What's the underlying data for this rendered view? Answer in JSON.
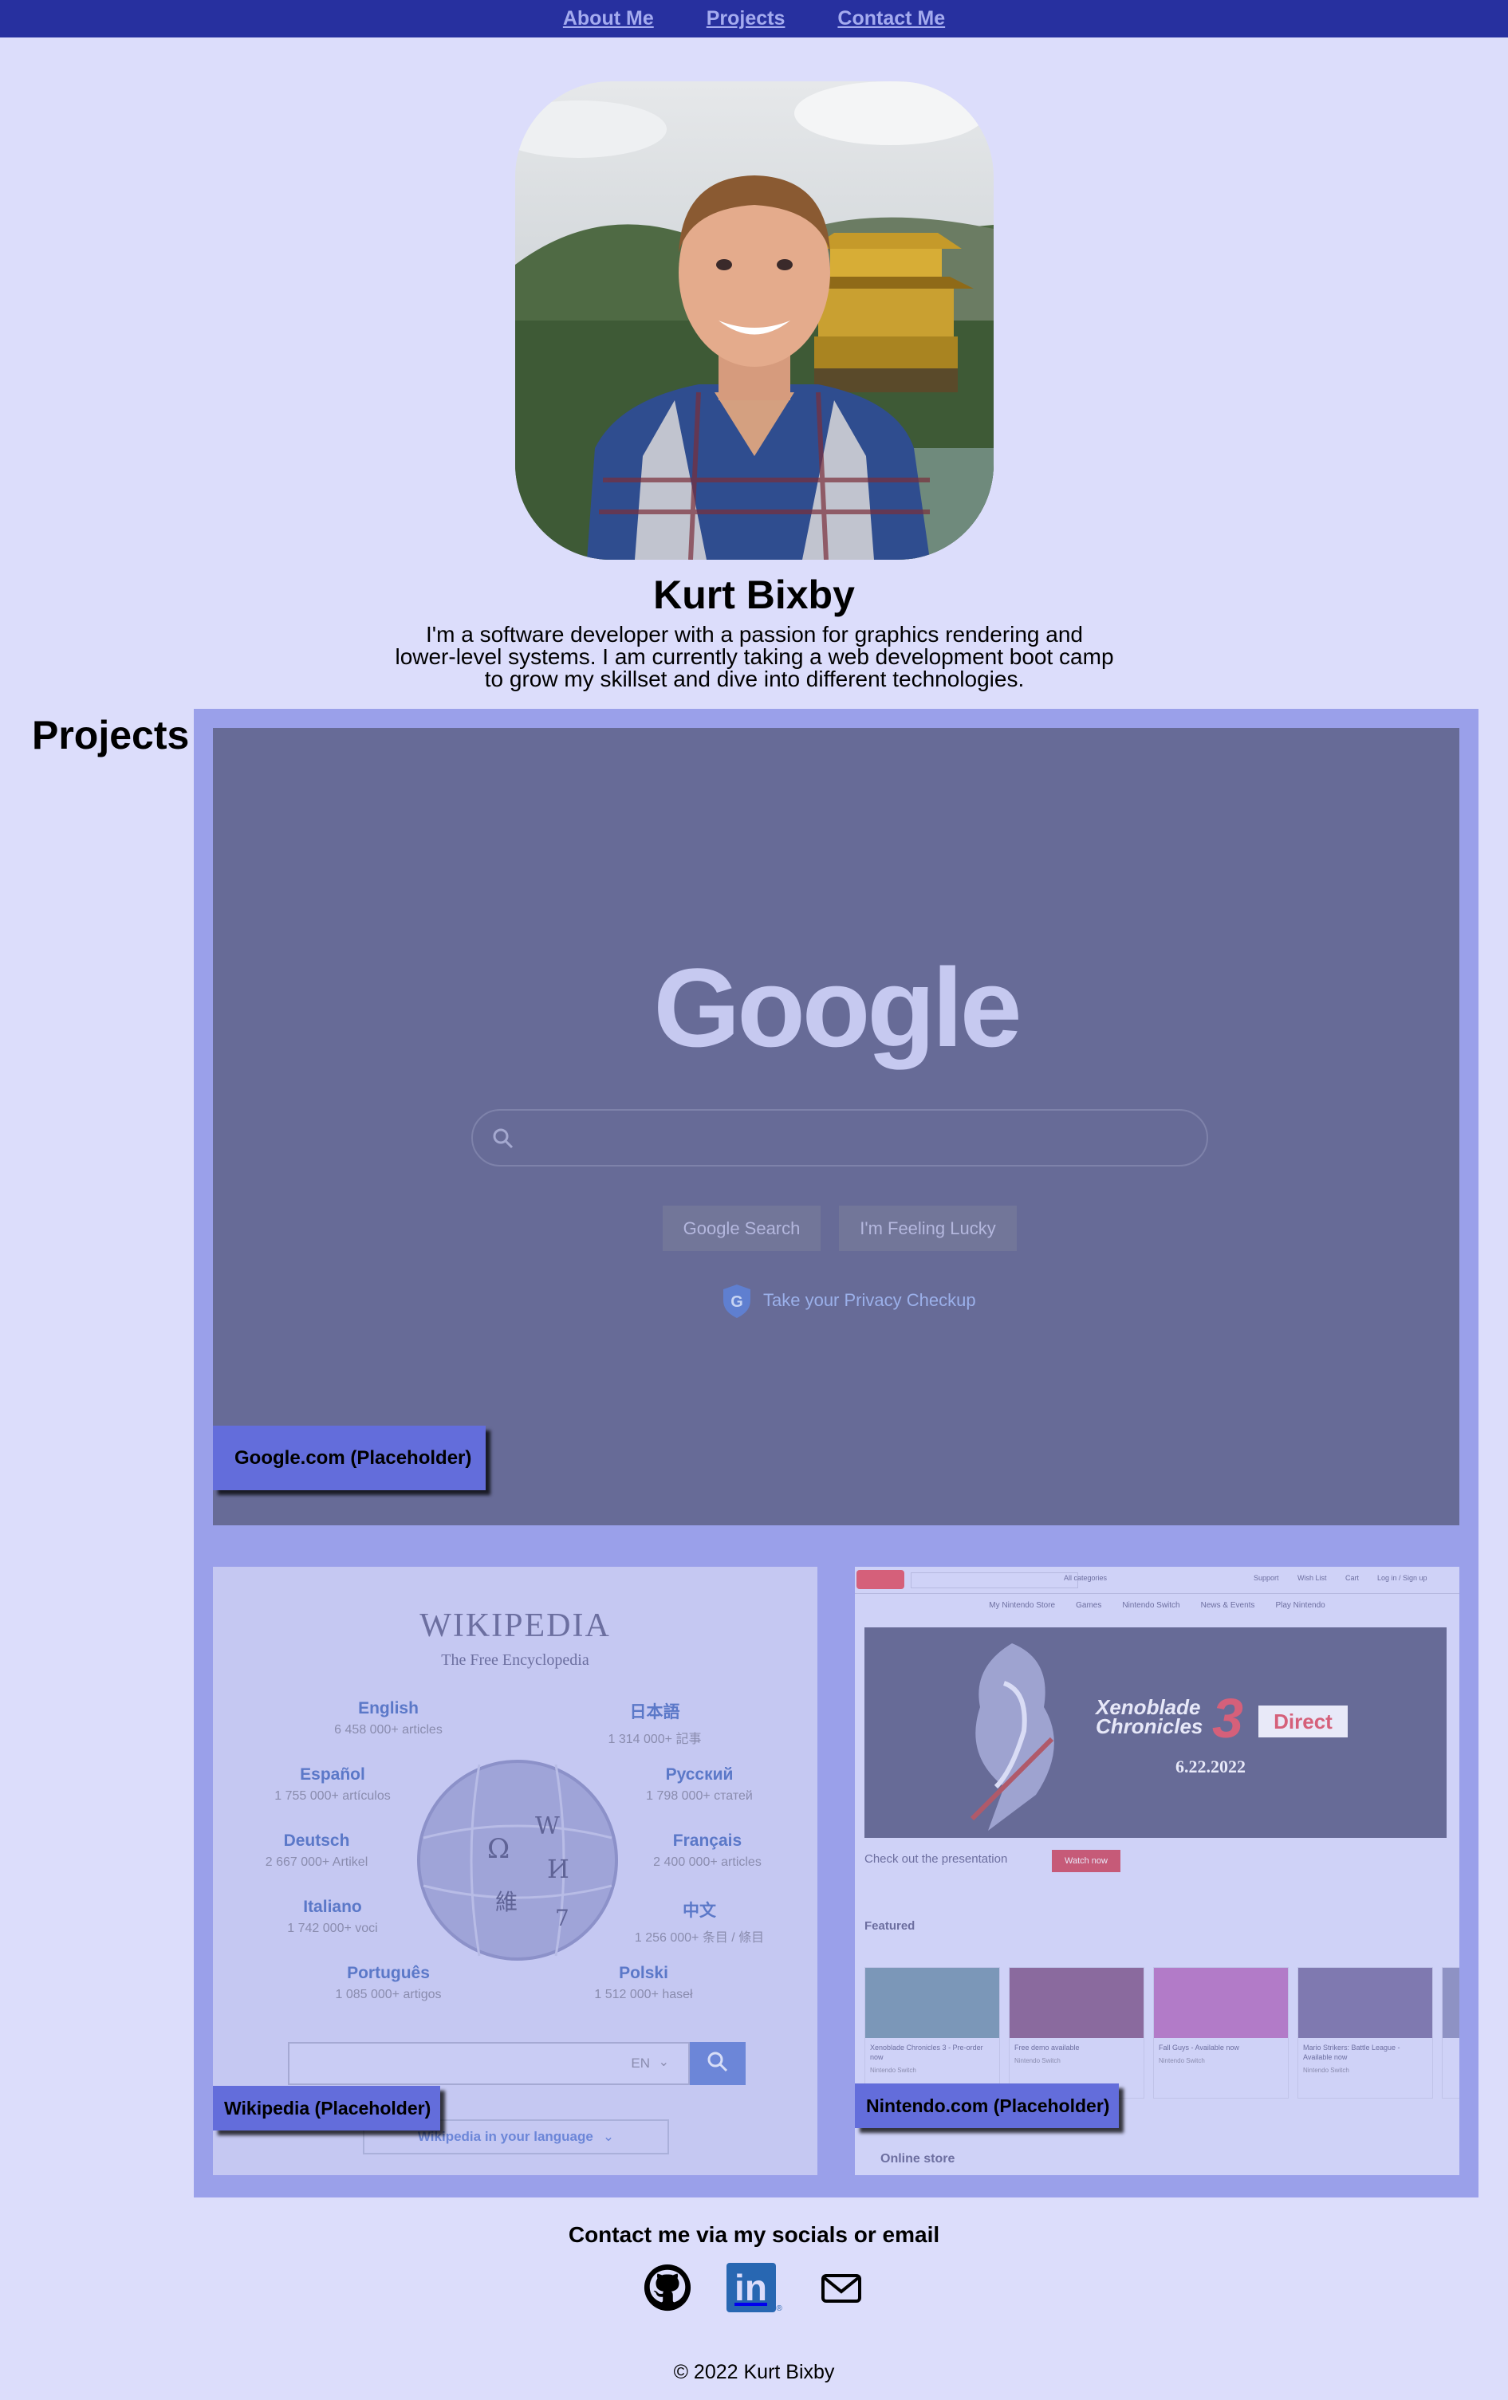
{
  "nav": {
    "items": [
      {
        "label": "About Me"
      },
      {
        "label": "Projects"
      },
      {
        "label": "Contact Me"
      }
    ]
  },
  "profile": {
    "name": "Kurt Bixby",
    "bio": "I'm a software developer with a passion for graphics rendering and lower-level systems. I am currently taking a web development boot camp to grow my skillset and dive into different technologies."
  },
  "projects": {
    "heading": "Projects",
    "items": [
      {
        "label": "Google.com (Placeholder)"
      },
      {
        "label": "Wikipedia (Placeholder)"
      },
      {
        "label": "Nintendo.com (Placeholder)"
      }
    ]
  },
  "google_preview": {
    "logo": "Google",
    "buttons": [
      "Google Search",
      "I'm Feeling Lucky"
    ],
    "privacy": "Take your Privacy Checkup"
  },
  "wiki_preview": {
    "title": "WIKIPEDIA",
    "tagline": "The Free Encyclopedia",
    "languages": [
      {
        "name": "English",
        "count": "6 458 000+ articles"
      },
      {
        "name": "日本語",
        "count": "1 314 000+ 記事"
      },
      {
        "name": "Español",
        "count": "1 755 000+ artículos"
      },
      {
        "name": "Русский",
        "count": "1 798 000+ статей"
      },
      {
        "name": "Deutsch",
        "count": "2 667 000+ Artikel"
      },
      {
        "name": "Français",
        "count": "2 400 000+ articles"
      },
      {
        "name": "Italiano",
        "count": "1 742 000+ voci"
      },
      {
        "name": "中文",
        "count": "1 256 000+ 条目 / 條目"
      },
      {
        "name": "Português",
        "count": "1 085 000+ artigos"
      },
      {
        "name": "Polski",
        "count": "1 512 000+ haseł"
      }
    ],
    "lang_code": "EN",
    "language_button": "Wikipedia in your language"
  },
  "nintendo_preview": {
    "top_links": [
      "Support",
      "Wish List",
      "Cart",
      "Log in / Sign up"
    ],
    "categories": "All categories",
    "nav_items": [
      "My Nintendo Store",
      "Games",
      "Nintendo Switch",
      "News & Events",
      "Play Nintendo"
    ],
    "banner_title_line1": "Xenoblade",
    "banner_title_line2": "Chronicles",
    "banner_number": "3",
    "banner_direct": "Direct",
    "banner_date": "6.22.2022",
    "presentation_text": "Check out the presentation",
    "watch_now": "Watch now",
    "featured": "Featured",
    "featured_items": [
      {
        "title": "Xenoblade Chronicles 3 - Pre-order now",
        "platform": "Nintendo Switch"
      },
      {
        "title": "Free demo available",
        "platform": "Nintendo Switch"
      },
      {
        "title": "Fall Guys - Available now",
        "platform": "Nintendo Switch"
      },
      {
        "title": "Mario Strikers: Battle League - Available now",
        "platform": "Nintendo Switch"
      }
    ],
    "online_store": "Online store"
  },
  "contact": {
    "heading": "Contact me via my socials or email",
    "socials": [
      {
        "icon": "github-icon"
      },
      {
        "icon": "linkedin-icon",
        "text": "in"
      },
      {
        "icon": "mail-icon"
      }
    ]
  },
  "footer": {
    "text": "© 2022 Kurt Bixby"
  },
  "colors": {
    "background": "#dcddfb",
    "navbar": "#27309f",
    "nav_link": "#a4abef",
    "panel": "#9aa0ea",
    "label": "#636ddb"
  }
}
